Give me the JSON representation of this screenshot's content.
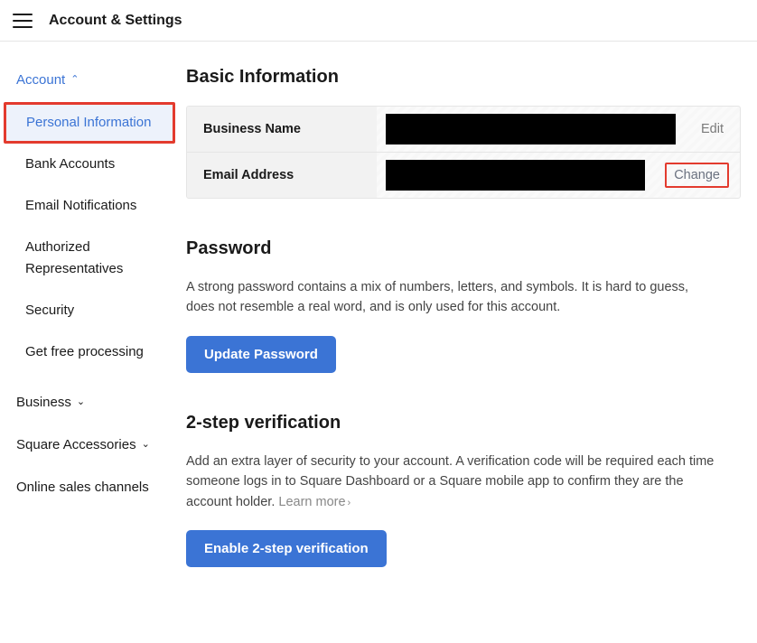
{
  "topbar": {
    "title": "Account & Settings"
  },
  "sidebar": {
    "groups": [
      {
        "label": "Account",
        "expanded": true,
        "items": [
          {
            "label": "Personal Information",
            "selected": true
          },
          {
            "label": "Bank Accounts"
          },
          {
            "label": "Email Notifications"
          },
          {
            "label": "Authorized Representatives"
          },
          {
            "label": "Security"
          },
          {
            "label": "Get free processing"
          }
        ]
      },
      {
        "label": "Business",
        "expanded": false
      },
      {
        "label": "Square Accessories",
        "expanded": false
      },
      {
        "label": "Online sales channels",
        "expanded": null
      }
    ]
  },
  "basic_info": {
    "title": "Basic Information",
    "rows": [
      {
        "label": "Business Name",
        "action": "Edit"
      },
      {
        "label": "Email Address",
        "action": "Change",
        "highlighted": true
      }
    ]
  },
  "password": {
    "title": "Password",
    "desc": "A strong password contains a mix of numbers, letters, and symbols. It is hard to guess, does not resemble a real word, and is only used for this account.",
    "button": "Update Password"
  },
  "two_step": {
    "title": "2-step verification",
    "desc": "Add an extra layer of security to your account. A verification code will be required each time someone logs in to Square Dashboard or a Square mobile app to confirm they are the account holder. ",
    "learn_more": "Learn more",
    "button": "Enable 2-step verification"
  }
}
